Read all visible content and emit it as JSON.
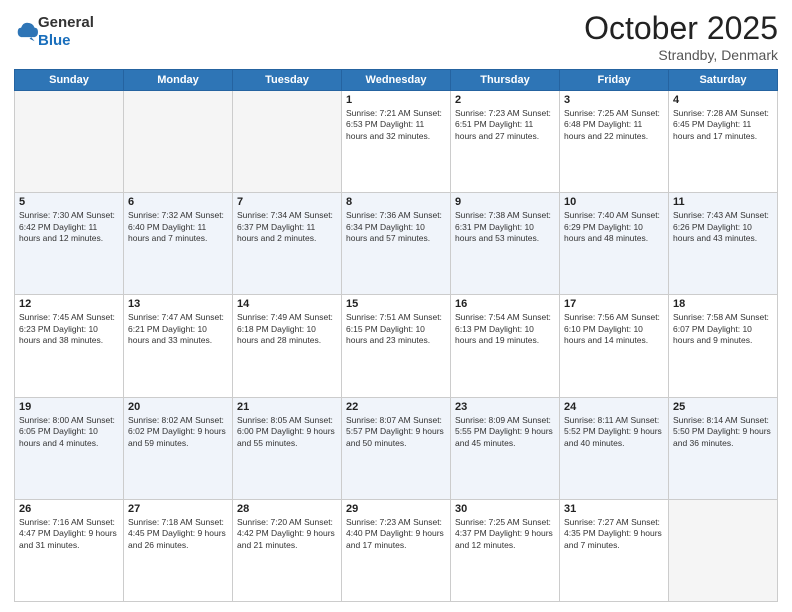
{
  "logo": {
    "general": "General",
    "blue": "Blue"
  },
  "title": {
    "month": "October 2025",
    "location": "Strandby, Denmark"
  },
  "weekdays": [
    "Sunday",
    "Monday",
    "Tuesday",
    "Wednesday",
    "Thursday",
    "Friday",
    "Saturday"
  ],
  "weeks": [
    [
      {
        "day": "",
        "text": ""
      },
      {
        "day": "",
        "text": ""
      },
      {
        "day": "",
        "text": ""
      },
      {
        "day": "1",
        "text": "Sunrise: 7:21 AM\nSunset: 6:53 PM\nDaylight: 11 hours\nand 32 minutes."
      },
      {
        "day": "2",
        "text": "Sunrise: 7:23 AM\nSunset: 6:51 PM\nDaylight: 11 hours\nand 27 minutes."
      },
      {
        "day": "3",
        "text": "Sunrise: 7:25 AM\nSunset: 6:48 PM\nDaylight: 11 hours\nand 22 minutes."
      },
      {
        "day": "4",
        "text": "Sunrise: 7:28 AM\nSunset: 6:45 PM\nDaylight: 11 hours\nand 17 minutes."
      }
    ],
    [
      {
        "day": "5",
        "text": "Sunrise: 7:30 AM\nSunset: 6:42 PM\nDaylight: 11 hours\nand 12 minutes."
      },
      {
        "day": "6",
        "text": "Sunrise: 7:32 AM\nSunset: 6:40 PM\nDaylight: 11 hours\nand 7 minutes."
      },
      {
        "day": "7",
        "text": "Sunrise: 7:34 AM\nSunset: 6:37 PM\nDaylight: 11 hours\nand 2 minutes."
      },
      {
        "day": "8",
        "text": "Sunrise: 7:36 AM\nSunset: 6:34 PM\nDaylight: 10 hours\nand 57 minutes."
      },
      {
        "day": "9",
        "text": "Sunrise: 7:38 AM\nSunset: 6:31 PM\nDaylight: 10 hours\nand 53 minutes."
      },
      {
        "day": "10",
        "text": "Sunrise: 7:40 AM\nSunset: 6:29 PM\nDaylight: 10 hours\nand 48 minutes."
      },
      {
        "day": "11",
        "text": "Sunrise: 7:43 AM\nSunset: 6:26 PM\nDaylight: 10 hours\nand 43 minutes."
      }
    ],
    [
      {
        "day": "12",
        "text": "Sunrise: 7:45 AM\nSunset: 6:23 PM\nDaylight: 10 hours\nand 38 minutes."
      },
      {
        "day": "13",
        "text": "Sunrise: 7:47 AM\nSunset: 6:21 PM\nDaylight: 10 hours\nand 33 minutes."
      },
      {
        "day": "14",
        "text": "Sunrise: 7:49 AM\nSunset: 6:18 PM\nDaylight: 10 hours\nand 28 minutes."
      },
      {
        "day": "15",
        "text": "Sunrise: 7:51 AM\nSunset: 6:15 PM\nDaylight: 10 hours\nand 23 minutes."
      },
      {
        "day": "16",
        "text": "Sunrise: 7:54 AM\nSunset: 6:13 PM\nDaylight: 10 hours\nand 19 minutes."
      },
      {
        "day": "17",
        "text": "Sunrise: 7:56 AM\nSunset: 6:10 PM\nDaylight: 10 hours\nand 14 minutes."
      },
      {
        "day": "18",
        "text": "Sunrise: 7:58 AM\nSunset: 6:07 PM\nDaylight: 10 hours\nand 9 minutes."
      }
    ],
    [
      {
        "day": "19",
        "text": "Sunrise: 8:00 AM\nSunset: 6:05 PM\nDaylight: 10 hours\nand 4 minutes."
      },
      {
        "day": "20",
        "text": "Sunrise: 8:02 AM\nSunset: 6:02 PM\nDaylight: 9 hours\nand 59 minutes."
      },
      {
        "day": "21",
        "text": "Sunrise: 8:05 AM\nSunset: 6:00 PM\nDaylight: 9 hours\nand 55 minutes."
      },
      {
        "day": "22",
        "text": "Sunrise: 8:07 AM\nSunset: 5:57 PM\nDaylight: 9 hours\nand 50 minutes."
      },
      {
        "day": "23",
        "text": "Sunrise: 8:09 AM\nSunset: 5:55 PM\nDaylight: 9 hours\nand 45 minutes."
      },
      {
        "day": "24",
        "text": "Sunrise: 8:11 AM\nSunset: 5:52 PM\nDaylight: 9 hours\nand 40 minutes."
      },
      {
        "day": "25",
        "text": "Sunrise: 8:14 AM\nSunset: 5:50 PM\nDaylight: 9 hours\nand 36 minutes."
      }
    ],
    [
      {
        "day": "26",
        "text": "Sunrise: 7:16 AM\nSunset: 4:47 PM\nDaylight: 9 hours\nand 31 minutes."
      },
      {
        "day": "27",
        "text": "Sunrise: 7:18 AM\nSunset: 4:45 PM\nDaylight: 9 hours\nand 26 minutes."
      },
      {
        "day": "28",
        "text": "Sunrise: 7:20 AM\nSunset: 4:42 PM\nDaylight: 9 hours\nand 21 minutes."
      },
      {
        "day": "29",
        "text": "Sunrise: 7:23 AM\nSunset: 4:40 PM\nDaylight: 9 hours\nand 17 minutes."
      },
      {
        "day": "30",
        "text": "Sunrise: 7:25 AM\nSunset: 4:37 PM\nDaylight: 9 hours\nand 12 minutes."
      },
      {
        "day": "31",
        "text": "Sunrise: 7:27 AM\nSunset: 4:35 PM\nDaylight: 9 hours\nand 7 minutes."
      },
      {
        "day": "",
        "text": ""
      }
    ]
  ]
}
